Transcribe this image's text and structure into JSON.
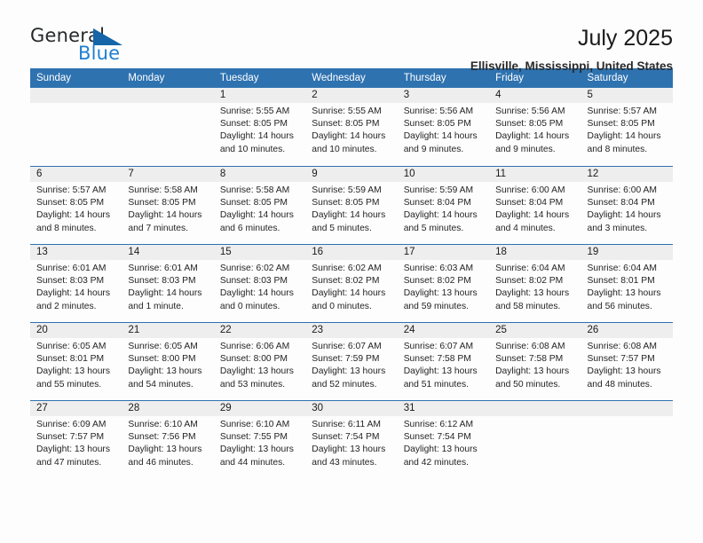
{
  "brand": {
    "name_part1": "General",
    "name_part2": "Blue",
    "triangle_color": "#1565a8",
    "blue_color": "#1f7fd0"
  },
  "header": {
    "title": "July 2025",
    "subtitle": "Ellisville, Mississippi, United States"
  },
  "theme": {
    "header_blue": "#2e72b0",
    "day_band_gray": "#eeeeee",
    "page_background": "#fdfdfd"
  },
  "weekdays": [
    "Sunday",
    "Monday",
    "Tuesday",
    "Wednesday",
    "Thursday",
    "Friday",
    "Saturday"
  ],
  "labels": {
    "sunrise": "Sunrise:",
    "sunset": "Sunset:",
    "daylight": "Daylight:"
  },
  "weeks": [
    [
      {
        "day": "",
        "sunrise": "",
        "sunset": "",
        "daylight": ""
      },
      {
        "day": "",
        "sunrise": "",
        "sunset": "",
        "daylight": ""
      },
      {
        "day": "1",
        "sunrise": "Sunrise: 5:55 AM",
        "sunset": "Sunset: 8:05 PM",
        "daylight": "Daylight: 14 hours and 10 minutes."
      },
      {
        "day": "2",
        "sunrise": "Sunrise: 5:55 AM",
        "sunset": "Sunset: 8:05 PM",
        "daylight": "Daylight: 14 hours and 10 minutes."
      },
      {
        "day": "3",
        "sunrise": "Sunrise: 5:56 AM",
        "sunset": "Sunset: 8:05 PM",
        "daylight": "Daylight: 14 hours and 9 minutes."
      },
      {
        "day": "4",
        "sunrise": "Sunrise: 5:56 AM",
        "sunset": "Sunset: 8:05 PM",
        "daylight": "Daylight: 14 hours and 9 minutes."
      },
      {
        "day": "5",
        "sunrise": "Sunrise: 5:57 AM",
        "sunset": "Sunset: 8:05 PM",
        "daylight": "Daylight: 14 hours and 8 minutes."
      }
    ],
    [
      {
        "day": "6",
        "sunrise": "Sunrise: 5:57 AM",
        "sunset": "Sunset: 8:05 PM",
        "daylight": "Daylight: 14 hours and 8 minutes."
      },
      {
        "day": "7",
        "sunrise": "Sunrise: 5:58 AM",
        "sunset": "Sunset: 8:05 PM",
        "daylight": "Daylight: 14 hours and 7 minutes."
      },
      {
        "day": "8",
        "sunrise": "Sunrise: 5:58 AM",
        "sunset": "Sunset: 8:05 PM",
        "daylight": "Daylight: 14 hours and 6 minutes."
      },
      {
        "day": "9",
        "sunrise": "Sunrise: 5:59 AM",
        "sunset": "Sunset: 8:05 PM",
        "daylight": "Daylight: 14 hours and 5 minutes."
      },
      {
        "day": "10",
        "sunrise": "Sunrise: 5:59 AM",
        "sunset": "Sunset: 8:04 PM",
        "daylight": "Daylight: 14 hours and 5 minutes."
      },
      {
        "day": "11",
        "sunrise": "Sunrise: 6:00 AM",
        "sunset": "Sunset: 8:04 PM",
        "daylight": "Daylight: 14 hours and 4 minutes."
      },
      {
        "day": "12",
        "sunrise": "Sunrise: 6:00 AM",
        "sunset": "Sunset: 8:04 PM",
        "daylight": "Daylight: 14 hours and 3 minutes."
      }
    ],
    [
      {
        "day": "13",
        "sunrise": "Sunrise: 6:01 AM",
        "sunset": "Sunset: 8:03 PM",
        "daylight": "Daylight: 14 hours and 2 minutes."
      },
      {
        "day": "14",
        "sunrise": "Sunrise: 6:01 AM",
        "sunset": "Sunset: 8:03 PM",
        "daylight": "Daylight: 14 hours and 1 minute."
      },
      {
        "day": "15",
        "sunrise": "Sunrise: 6:02 AM",
        "sunset": "Sunset: 8:03 PM",
        "daylight": "Daylight: 14 hours and 0 minutes."
      },
      {
        "day": "16",
        "sunrise": "Sunrise: 6:02 AM",
        "sunset": "Sunset: 8:02 PM",
        "daylight": "Daylight: 14 hours and 0 minutes."
      },
      {
        "day": "17",
        "sunrise": "Sunrise: 6:03 AM",
        "sunset": "Sunset: 8:02 PM",
        "daylight": "Daylight: 13 hours and 59 minutes."
      },
      {
        "day": "18",
        "sunrise": "Sunrise: 6:04 AM",
        "sunset": "Sunset: 8:02 PM",
        "daylight": "Daylight: 13 hours and 58 minutes."
      },
      {
        "day": "19",
        "sunrise": "Sunrise: 6:04 AM",
        "sunset": "Sunset: 8:01 PM",
        "daylight": "Daylight: 13 hours and 56 minutes."
      }
    ],
    [
      {
        "day": "20",
        "sunrise": "Sunrise: 6:05 AM",
        "sunset": "Sunset: 8:01 PM",
        "daylight": "Daylight: 13 hours and 55 minutes."
      },
      {
        "day": "21",
        "sunrise": "Sunrise: 6:05 AM",
        "sunset": "Sunset: 8:00 PM",
        "daylight": "Daylight: 13 hours and 54 minutes."
      },
      {
        "day": "22",
        "sunrise": "Sunrise: 6:06 AM",
        "sunset": "Sunset: 8:00 PM",
        "daylight": "Daylight: 13 hours and 53 minutes."
      },
      {
        "day": "23",
        "sunrise": "Sunrise: 6:07 AM",
        "sunset": "Sunset: 7:59 PM",
        "daylight": "Daylight: 13 hours and 52 minutes."
      },
      {
        "day": "24",
        "sunrise": "Sunrise: 6:07 AM",
        "sunset": "Sunset: 7:58 PM",
        "daylight": "Daylight: 13 hours and 51 minutes."
      },
      {
        "day": "25",
        "sunrise": "Sunrise: 6:08 AM",
        "sunset": "Sunset: 7:58 PM",
        "daylight": "Daylight: 13 hours and 50 minutes."
      },
      {
        "day": "26",
        "sunrise": "Sunrise: 6:08 AM",
        "sunset": "Sunset: 7:57 PM",
        "daylight": "Daylight: 13 hours and 48 minutes."
      }
    ],
    [
      {
        "day": "27",
        "sunrise": "Sunrise: 6:09 AM",
        "sunset": "Sunset: 7:57 PM",
        "daylight": "Daylight: 13 hours and 47 minutes."
      },
      {
        "day": "28",
        "sunrise": "Sunrise: 6:10 AM",
        "sunset": "Sunset: 7:56 PM",
        "daylight": "Daylight: 13 hours and 46 minutes."
      },
      {
        "day": "29",
        "sunrise": "Sunrise: 6:10 AM",
        "sunset": "Sunset: 7:55 PM",
        "daylight": "Daylight: 13 hours and 44 minutes."
      },
      {
        "day": "30",
        "sunrise": "Sunrise: 6:11 AM",
        "sunset": "Sunset: 7:54 PM",
        "daylight": "Daylight: 13 hours and 43 minutes."
      },
      {
        "day": "31",
        "sunrise": "Sunrise: 6:12 AM",
        "sunset": "Sunset: 7:54 PM",
        "daylight": "Daylight: 13 hours and 42 minutes."
      },
      {
        "day": "",
        "sunrise": "",
        "sunset": "",
        "daylight": ""
      },
      {
        "day": "",
        "sunrise": "",
        "sunset": "",
        "daylight": ""
      }
    ]
  ]
}
